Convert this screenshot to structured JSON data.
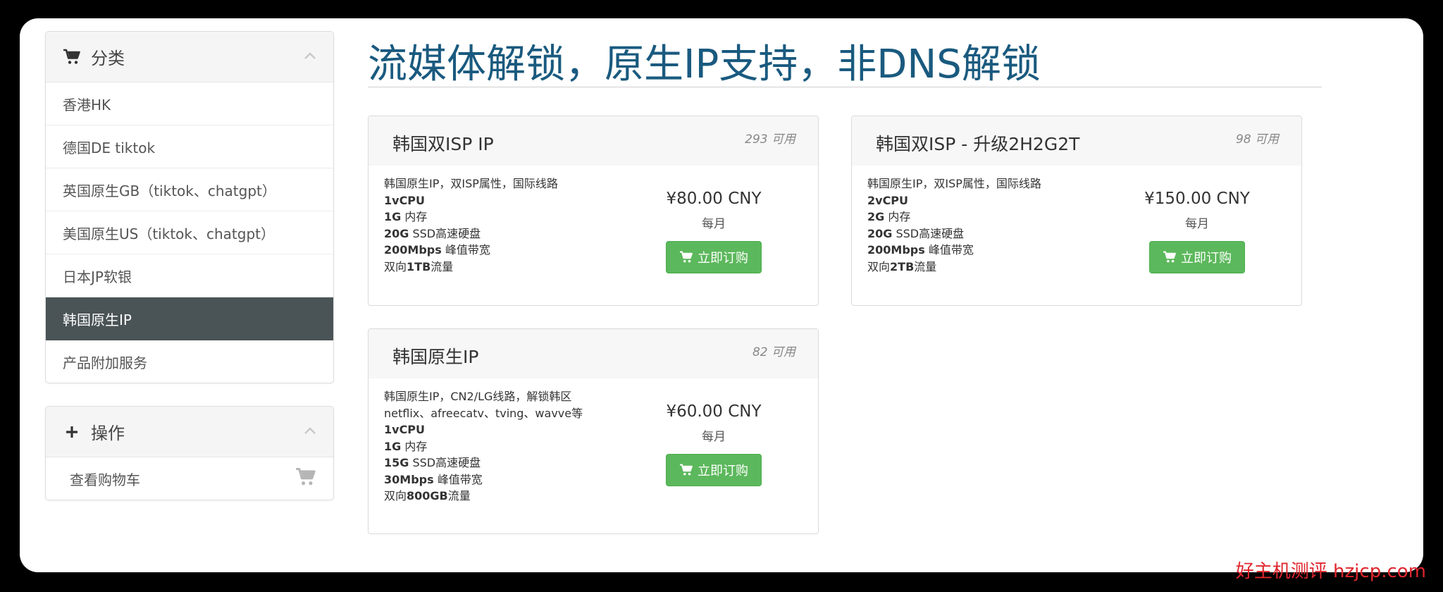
{
  "sidebar": {
    "categories_title": "分类",
    "categories": [
      {
        "label": "香港HK",
        "active": false
      },
      {
        "label": "德国DE tiktok",
        "active": false
      },
      {
        "label": "英国原生GB（tiktok、chatgpt）",
        "active": false
      },
      {
        "label": "美国原生US（tiktok、chatgpt）",
        "active": false
      },
      {
        "label": "日本JP软银",
        "active": false
      },
      {
        "label": "韩国原生IP",
        "active": true
      },
      {
        "label": "产品附加服务",
        "active": false
      }
    ],
    "actions_title": "操作",
    "view_cart_label": "查看购物车"
  },
  "main": {
    "title": "流媒体解锁，原生IP支持，非DNS解锁",
    "products": [
      {
        "name": "韩国双ISP IP",
        "qty": "293 可用",
        "desc": "韩国原生IP，双ISP属性，国际线路",
        "specs": [
          {
            "bold": "1vCPU",
            "text": ""
          },
          {
            "bold": "1G",
            "text": " 内存"
          },
          {
            "bold": "20G",
            "text": " SSD高速硬盘"
          },
          {
            "bold": "200Mbps",
            "text": " 峰值带宽"
          },
          {
            "bold": "",
            "text": "双向",
            "bold2": "1TB",
            "text2": "流量"
          }
        ],
        "price": "¥80.00 CNY",
        "period": "每月",
        "button": "立即订购"
      },
      {
        "name": "韩国双ISP - 升级2H2G2T",
        "qty": "98 可用",
        "desc": "韩国原生IP，双ISP属性，国际线路",
        "specs": [
          {
            "bold": "2vCPU",
            "text": ""
          },
          {
            "bold": "2G",
            "text": " 内存"
          },
          {
            "bold": "20G",
            "text": " SSD高速硬盘"
          },
          {
            "bold": "200Mbps",
            "text": " 峰值带宽"
          },
          {
            "bold": "",
            "text": "双向",
            "bold2": "2TB",
            "text2": "流量"
          }
        ],
        "price": "¥150.00 CNY",
        "period": "每月",
        "button": "立即订购"
      },
      {
        "name": "韩国原生IP",
        "qty": "82 可用",
        "desc": "韩国原生IP，CN2/LG线路，解锁韩区",
        "desc2": "netflix、afreecatv、tving、wavve等",
        "specs": [
          {
            "bold": "1vCPU",
            "text": ""
          },
          {
            "bold": "1G",
            "text": " 内存"
          },
          {
            "bold": "15G",
            "text": " SSD高速硬盘"
          },
          {
            "bold": "30Mbps",
            "text": " 峰值带宽"
          },
          {
            "bold": "",
            "text": "双向",
            "bold2": "800GB",
            "text2": "流量"
          }
        ],
        "price": "¥60.00 CNY",
        "period": "每月",
        "button": "立即订购"
      }
    ]
  },
  "watermark": "好主机测评 hzjcp.com",
  "colors": {
    "title": "#1a5a7f",
    "active_item_bg": "#4a5356",
    "button_green": "#5cb85c",
    "watermark": "#e0262e"
  }
}
